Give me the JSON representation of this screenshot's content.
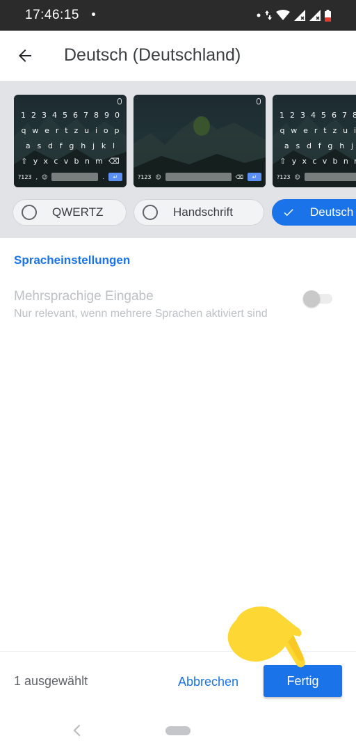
{
  "status_bar": {
    "time": "17:46:15",
    "icons": [
      "notification-dot-icon",
      "data-arrows-icon",
      "wifi-icon",
      "signal-icon",
      "signal-icon",
      "battery-low-icon"
    ],
    "battery_color": "#e53935"
  },
  "app_bar": {
    "back_icon": "arrow-left-icon",
    "title": "Deutsch (Deutschland)"
  },
  "layouts": {
    "keyboard_rows": [
      [
        "1",
        "2",
        "3",
        "4",
        "5",
        "6",
        "7",
        "8",
        "9",
        "0"
      ],
      [
        "q",
        "w",
        "e",
        "r",
        "t",
        "z",
        "u",
        "i",
        "o",
        "p"
      ],
      [
        "a",
        "s",
        "d",
        "f",
        "g",
        "h",
        "j",
        "k",
        "l"
      ],
      [
        "y",
        "x",
        "c",
        "v",
        "b",
        "n",
        "m"
      ]
    ],
    "bottom_row": {
      "symbols_key": "?123",
      "comma": ",",
      "emoji": "☺",
      "period": "."
    },
    "chips": [
      {
        "label": "QWERTZ",
        "selected": false
      },
      {
        "label": "Handschrift",
        "selected": false
      },
      {
        "label": "Deutsch",
        "selected": true
      }
    ]
  },
  "settings": {
    "section_header": "Spracheinstellungen",
    "multilingual": {
      "title": "Mehrsprachige Eingabe",
      "subtitle": "Nur relevant, wenn mehrere Sprachen aktiviert sind",
      "enabled": false
    }
  },
  "action_bar": {
    "selected_count": "1 ausgewählt",
    "cancel_label": "Abbrechen",
    "done_label": "Fertig"
  },
  "colors": {
    "accent": "#1a73e8",
    "hand": "#fdd835"
  }
}
